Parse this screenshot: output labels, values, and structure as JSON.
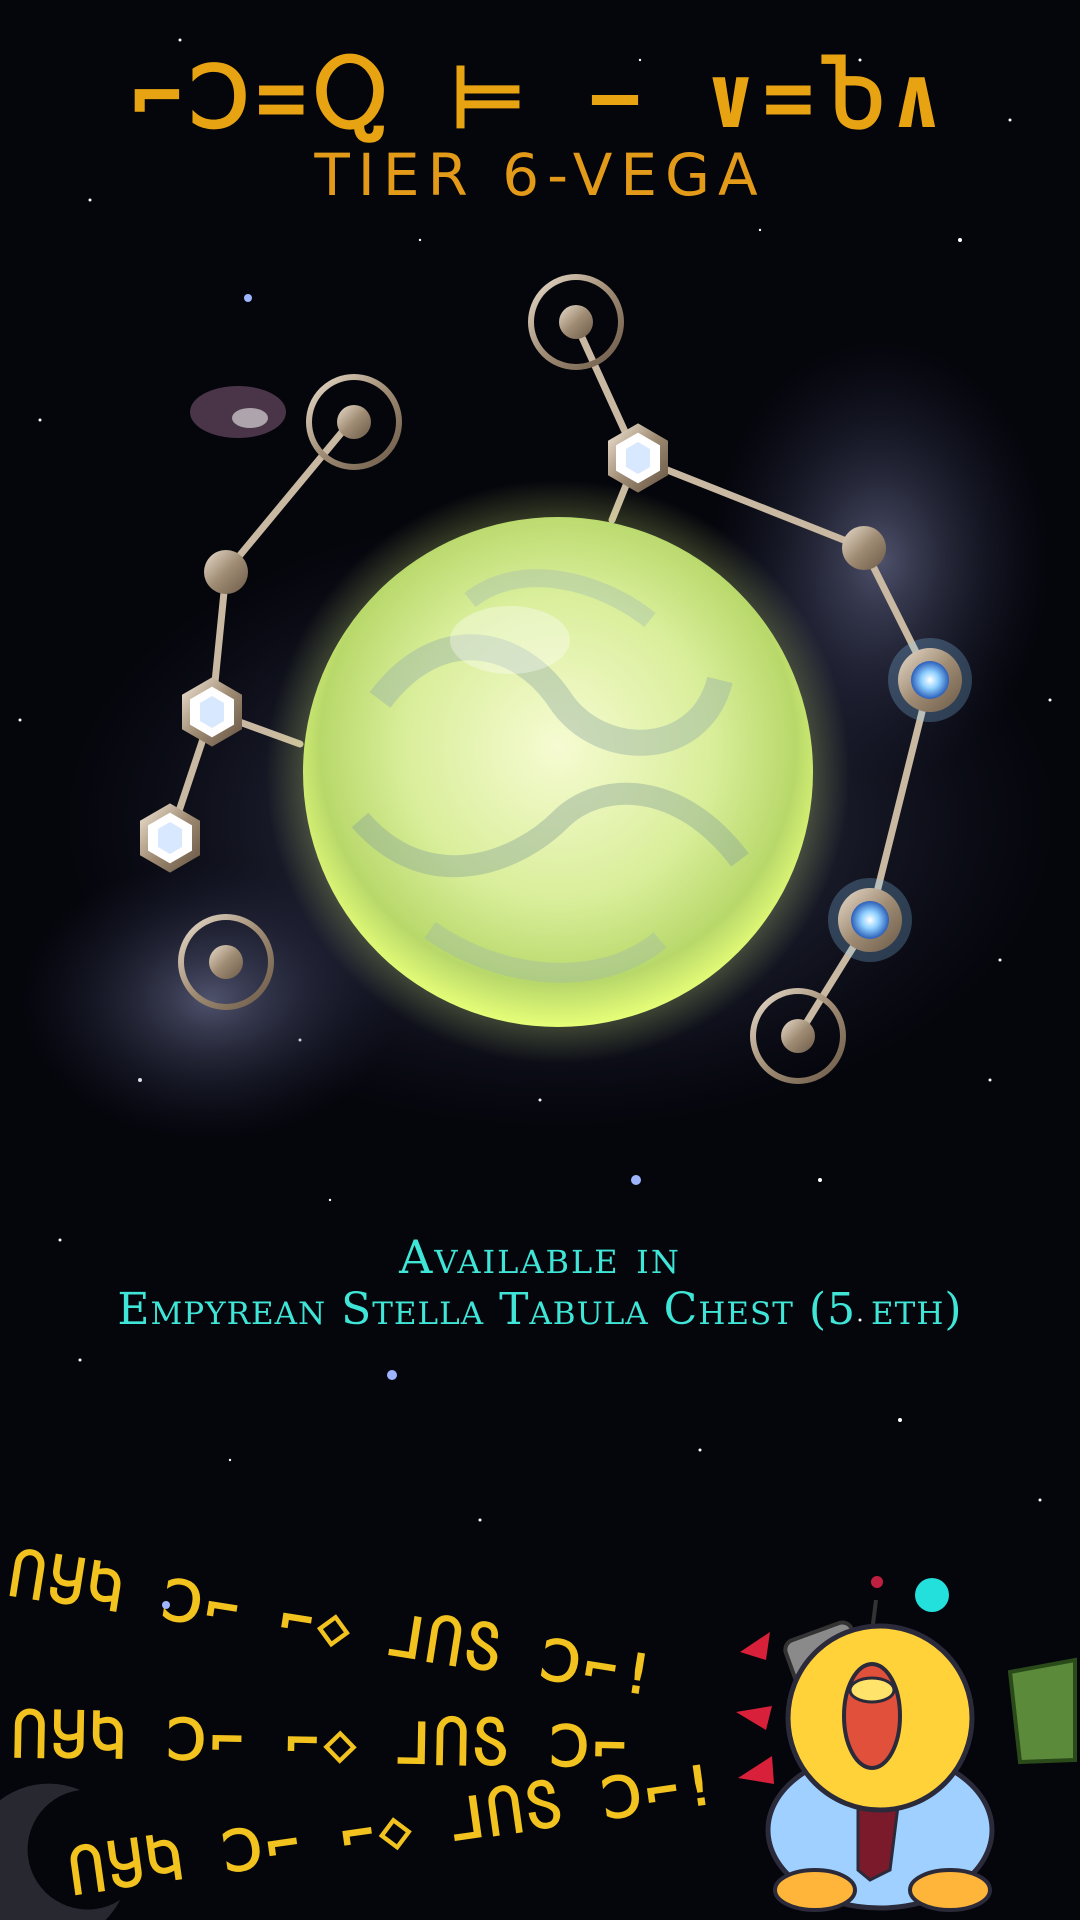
{
  "header": {
    "alien_title": "⌐Ↄ=Ⴍ ⊨ − ∨=Ⴆ∧",
    "tier_label": "TIER 6-VEGA"
  },
  "availability": {
    "line1": "Available in",
    "line2": "Empyrean Stella Tabula Chest (5 eth)"
  },
  "shouts": [
    "ႶႸႩ Ↄ⌐ ⌐◇ ⅃ႶႽ Ↄ⌐!",
    "ႶႸႩ Ↄ⌐ ⌐◇ ⅃ႶႽ Ↄ⌐",
    "ႶႸႩ Ↄ⌐ ⌐◇ ⅃ႶႽ Ↄ⌐!"
  ],
  "colors": {
    "title": "#e8a312",
    "tier": "#e29a18",
    "availability": "#3fe6d8",
    "shout": "#f2c21e",
    "star_core": "#eef5a8",
    "node_blue": "#8fd0ff",
    "background": "#05060c"
  },
  "icons": [
    "vega-star-orb",
    "constellation-node-hex",
    "constellation-node-ring",
    "constellation-node-glow",
    "mascot-shouting-duck",
    "watermark-moon"
  ]
}
